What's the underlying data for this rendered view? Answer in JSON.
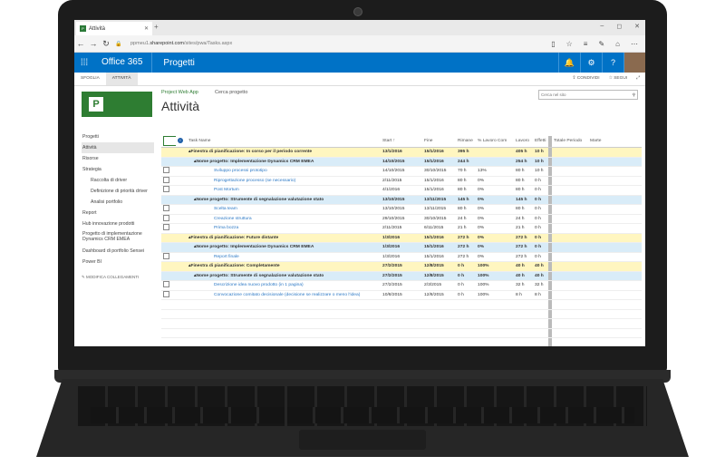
{
  "browser": {
    "tab_title": "Attività",
    "new_tab": "+",
    "win_min": "–",
    "win_max": "◻",
    "win_close": "✕",
    "url_prefix": "ppmeu1.",
    "url_domain": "sharepoint.com",
    "url_path": "/sites/pwa/Tasks.aspx"
  },
  "suite": {
    "app": "Office 365",
    "site": "Progetti"
  },
  "ribbon": {
    "tabs": [
      "SFOGLIA",
      "ATTIVITÀ"
    ],
    "share": "CONDIVIDI",
    "follow": "SEGUI"
  },
  "header": {
    "logo_letter": "P",
    "crumb_home": "Project Web App",
    "crumb_link": "Cerca progetto",
    "title": "Attività",
    "search_placeholder": "Cerca nel sito"
  },
  "leftnav": {
    "items": [
      {
        "label": "Progetti"
      },
      {
        "label": "Attività"
      },
      {
        "label": "Risorse"
      },
      {
        "label": "Strategia"
      },
      {
        "label": "Raccolta di driver"
      },
      {
        "label": "Definizione di priorità driver"
      },
      {
        "label": "Analisi portfolio"
      },
      {
        "label": "Report"
      },
      {
        "label": "Hub innovazione prodotti"
      },
      {
        "label": "Progetto di implementazione Dynamics CRM EMEA"
      },
      {
        "label": "Dashboard di portfolio Sensei"
      },
      {
        "label": "Power BI"
      }
    ],
    "edit_links": "✎ MODIFICA COLLEGAMENTI"
  },
  "grid": {
    "columns": [
      "",
      "",
      "Task Name",
      "Start ↑",
      "Fine",
      "Rimane",
      "% Lavoro Com",
      "Lavoro",
      "Effetti",
      "Totale Periodo",
      "Marte"
    ],
    "rows": [
      {
        "kind": "window",
        "name": "▴Finestra di pianificazione: In corso per il periodo corrente",
        "start": "13/1/2016",
        "end": "15/1/2016",
        "rem": "395 h",
        "pct": "",
        "work": "405 h",
        "eff": "10 h"
      },
      {
        "kind": "project",
        "name": "▴Nome progetto: Implementazione Dynamics CRM EMEA",
        "start": "14/10/2015",
        "end": "15/1/2016",
        "rem": "244 h",
        "pct": "",
        "work": "254 h",
        "eff": "10 h"
      },
      {
        "kind": "task",
        "name": "Sviluppo processi prototipo",
        "start": "14/10/2015",
        "end": "30/10/2015",
        "rem": "70 h",
        "pct": "13%",
        "work": "80 h",
        "eff": "10 h"
      },
      {
        "kind": "task",
        "name": "Riprogettazione processo (se necessario)",
        "start": "2/11/2015",
        "end": "15/1/2016",
        "rem": "80 h",
        "pct": "0%",
        "work": "80 h",
        "eff": "0 h"
      },
      {
        "kind": "task",
        "name": "Post Mortum",
        "start": "4/1/2016",
        "end": "15/1/2016",
        "rem": "80 h",
        "pct": "0%",
        "work": "80 h",
        "eff": "0 h"
      },
      {
        "kind": "project",
        "name": "▴Nome progetto: Strumente di segnalazione valutazione stato",
        "start": "13/10/2015",
        "end": "13/11/2015",
        "rem": "145 h",
        "pct": "0%",
        "work": "145 h",
        "eff": "0 h"
      },
      {
        "kind": "task",
        "name": "Scelta team",
        "start": "13/10/2015",
        "end": "13/11/2015",
        "rem": "80 h",
        "pct": "0%",
        "work": "80 h",
        "eff": "0 h"
      },
      {
        "kind": "task",
        "name": "Creazione struttura",
        "start": "29/10/2015",
        "end": "30/10/2015",
        "rem": "24 h",
        "pct": "0%",
        "work": "24 h",
        "eff": "0 h"
      },
      {
        "kind": "task",
        "name": "Prima bozza",
        "start": "2/11/2015",
        "end": "6/11/2015",
        "rem": "21 h",
        "pct": "0%",
        "work": "21 h",
        "eff": "0 h"
      },
      {
        "kind": "window",
        "name": "▴Finestra di pianificazione: Future distante",
        "start": "1/3/2016",
        "end": "15/1/2016",
        "rem": "272 h",
        "pct": "0%",
        "work": "272 h",
        "eff": "0 h"
      },
      {
        "kind": "project",
        "name": "▴Nome progetto: Implementazione Dynamics CRM EMEA",
        "start": "1/3/2016",
        "end": "15/1/2016",
        "rem": "272 h",
        "pct": "0%",
        "work": "272 h",
        "eff": "0 h"
      },
      {
        "kind": "task",
        "name": "Report finale",
        "start": "1/3/2016",
        "end": "15/1/2016",
        "rem": "272 h",
        "pct": "0%",
        "work": "272 h",
        "eff": "0 h"
      },
      {
        "kind": "window",
        "name": "▴Finestra di pianificazione: Completamente",
        "start": "27/2/2015",
        "end": "12/8/2015",
        "rem": "0 h",
        "pct": "100%",
        "work": "40 h",
        "eff": "40 h"
      },
      {
        "kind": "project",
        "name": "▴Nome progetto: Strumente di segnalazione valutazione stato",
        "start": "27/2/2015",
        "end": "12/8/2015",
        "rem": "0 h",
        "pct": "100%",
        "work": "40 h",
        "eff": "40 h"
      },
      {
        "kind": "task",
        "name": "Descrizione idea nuovo prodotto (in 1 pagina)",
        "start": "27/2/2015",
        "end": "2/3/2015",
        "rem": "0 h",
        "pct": "100%",
        "work": "32 h",
        "eff": "32 h"
      },
      {
        "kind": "task",
        "name": "Convocazione comitato decisionale (decisione se realizzare o meno l'idea)",
        "start": "10/8/2015",
        "end": "12/8/2015",
        "rem": "0 h",
        "pct": "100%",
        "work": "8 h",
        "eff": "8 h"
      }
    ]
  },
  "colors": {
    "suite_blue": "#0072c6",
    "brand_green": "#2e7d32",
    "window_row": "#fff6c0",
    "project_row": "#d9ecf8"
  }
}
